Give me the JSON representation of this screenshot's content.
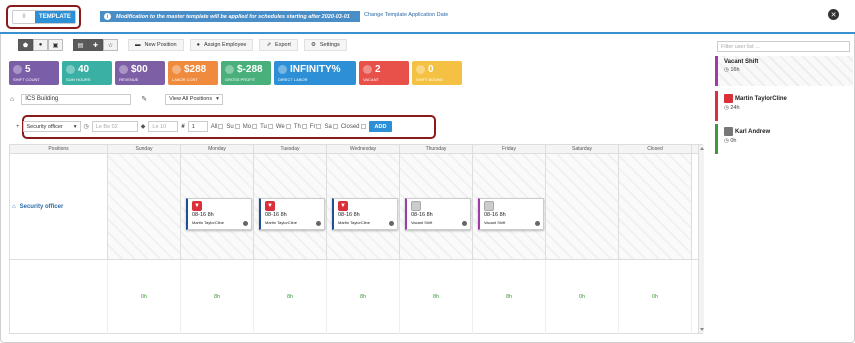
{
  "header": {
    "toggle_off_label": "II",
    "toggle_on_label": "TEMPLATE",
    "notice_text": "Modification to the master template will be applied for schedules starting after 2020-03-01",
    "change_link": "Change Template Application Date"
  },
  "toolbar": {
    "new_position": "New Position",
    "assign_employee": "Assign Employee",
    "export": "Export",
    "settings": "Settings"
  },
  "stats": [
    {
      "value": "5",
      "label": "SHIFT COUNT",
      "color": "#7b5ea8"
    },
    {
      "value": "40",
      "label": "SUM HOURS",
      "color": "#3ab0a4"
    },
    {
      "value": "$00",
      "label": "REVENUE",
      "color": "#7d5fa5"
    },
    {
      "value": "$288",
      "label": "LABOR COST",
      "color": "#f08a3c"
    },
    {
      "value": "$-288",
      "label": "GROSS PROFIT",
      "color": "#49b07c"
    },
    {
      "value": "INFINITY%",
      "label": "DIRECT LABOR",
      "color": "#2d8fd5"
    },
    {
      "value": "2",
      "label": "VACANT",
      "color": "#e8504a"
    },
    {
      "value": "0",
      "label": "SHIFT BOUND",
      "color": "#f5c142"
    }
  ],
  "building": {
    "name": "ICS Building",
    "view_select": "View All Positions"
  },
  "filter": {
    "position": "Security officer",
    "start_time": "Le Be 02",
    "end_time": "Le 10",
    "count": "1",
    "days": [
      "All",
      "Su",
      "Mo",
      "Tu",
      "We",
      "Th",
      "Fr",
      "Sa",
      "Closed"
    ],
    "add_label": "ADD"
  },
  "grid": {
    "columns": [
      "Positions",
      "Sunday",
      "Monday",
      "Tuesday",
      "Wednesday",
      "Thursday",
      "Friday",
      "Saturday",
      "Closed"
    ],
    "position_name": "Security officer",
    "totals": [
      "0h",
      "8h",
      "8h",
      "8h",
      "8h",
      "8h",
      "0h",
      "0h"
    ],
    "shifts": [
      {
        "time": "08-16",
        "hours": "8h",
        "who": "Martin TaylorCline",
        "color": "#d9303a"
      },
      {
        "time": "08-16",
        "hours": "8h",
        "who": "Martin TaylorCline",
        "color": "#d9303a"
      },
      {
        "time": "08-16",
        "hours": "8h",
        "who": "Martin TaylorCline",
        "color": "#d9303a"
      },
      {
        "time": "08-16",
        "hours": "8h",
        "who": "Vacant Shift",
        "color": "#a03aa8"
      },
      {
        "time": "08-16",
        "hours": "8h",
        "who": "Vacant Shift",
        "color": "#a03aa8"
      }
    ]
  },
  "right_panel": {
    "filter_placeholder": "Filter user list ...",
    "users": [
      {
        "name": "Vacant Shift",
        "hours": "16h",
        "color": "#a03aa8"
      },
      {
        "name": "Martin TaylorCline",
        "hours": "24h",
        "color": "#d9303a"
      },
      {
        "name": "Karl Andrew",
        "hours": "0h",
        "color": "#3c9a3c"
      }
    ]
  },
  "colors": {
    "accent": "#2d8fd5",
    "highlight_border": "#8b1a1a"
  }
}
